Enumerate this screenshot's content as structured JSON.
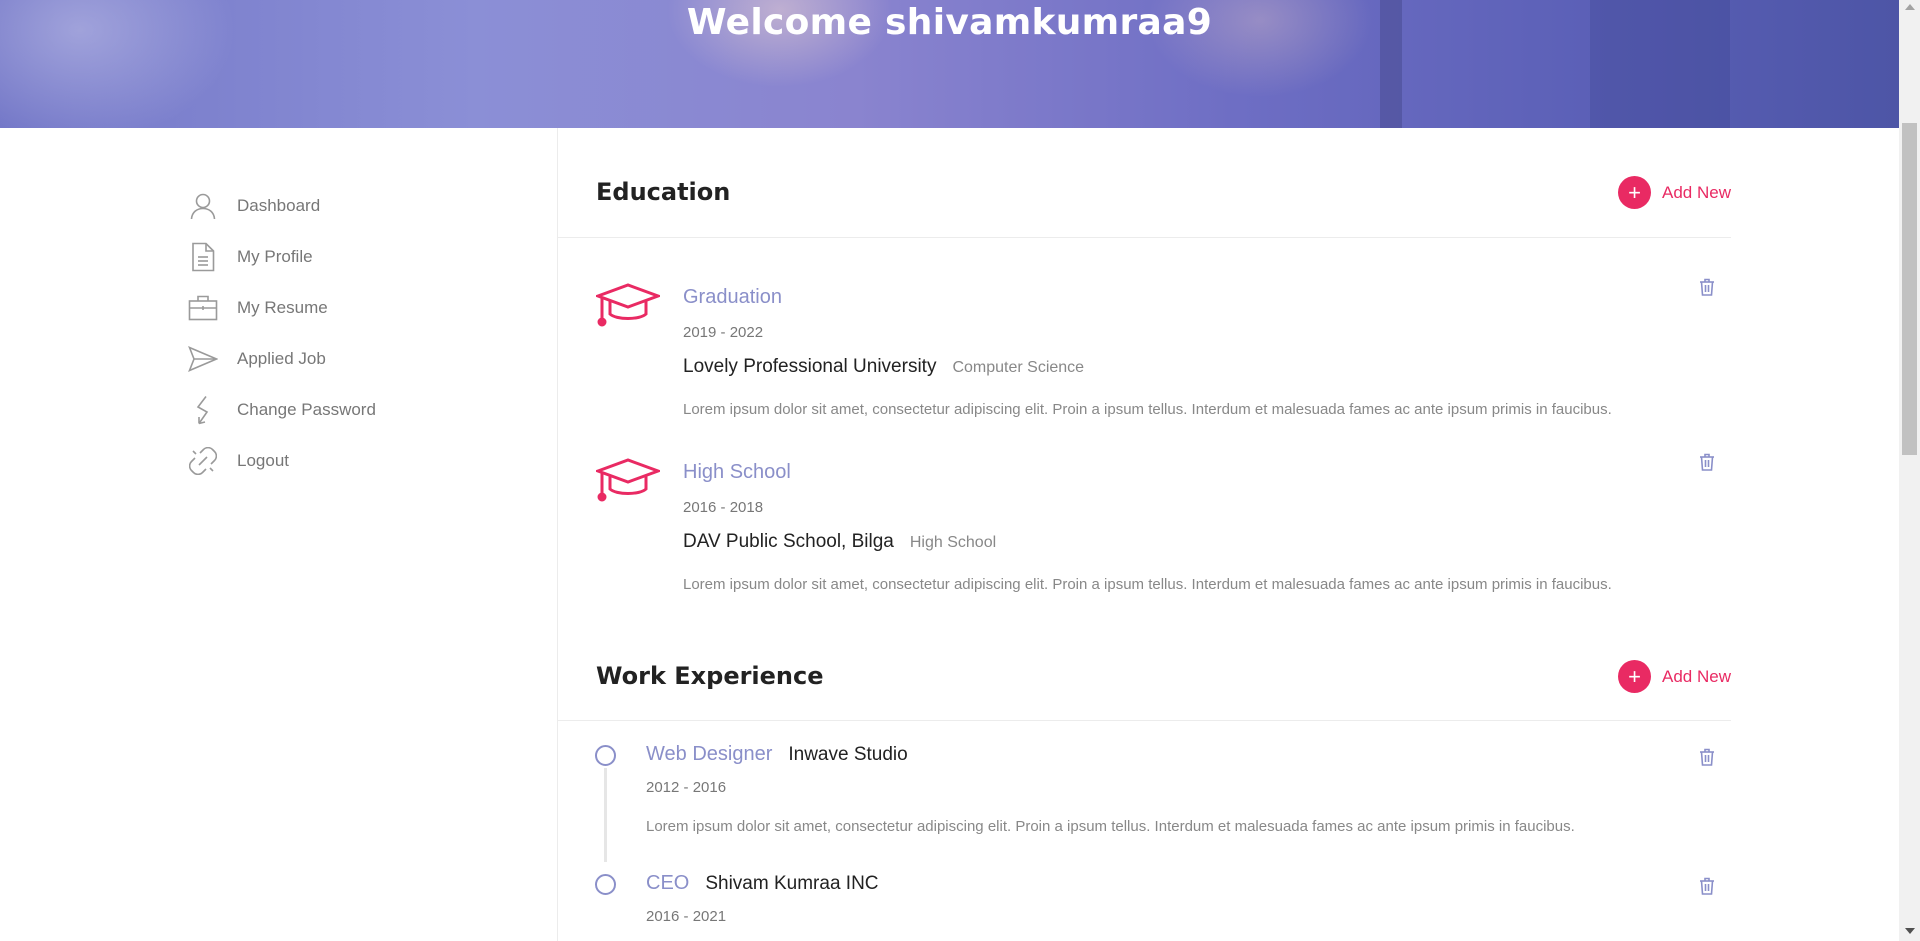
{
  "banner": {
    "title": "Welcome shivamkumraa9"
  },
  "sidebar": {
    "items": [
      {
        "label": "Dashboard",
        "icon": "user-icon"
      },
      {
        "label": "My Profile",
        "icon": "document-icon"
      },
      {
        "label": "My Resume",
        "icon": "briefcase-icon"
      },
      {
        "label": "Applied Job",
        "icon": "paper-plane-icon"
      },
      {
        "label": "Change Password",
        "icon": "lightning-icon"
      },
      {
        "label": "Logout",
        "icon": "broken-link-icon"
      }
    ]
  },
  "education": {
    "title": "Education",
    "add_label": "Add New",
    "items": [
      {
        "degree": "Graduation",
        "years": "2019 - 2022",
        "school": "Lovely Professional University",
        "field": "Computer Science",
        "description": "Lorem ipsum dolor sit amet, consectetur adipiscing elit. Proin a ipsum tellus. Interdum et malesuada fames ac ante ipsum primis in faucibus."
      },
      {
        "degree": "High School",
        "years": "2016 - 2018",
        "school": "DAV Public School, Bilga",
        "field": "High School",
        "description": "Lorem ipsum dolor sit amet, consectetur adipiscing elit. Proin a ipsum tellus. Interdum et malesuada fames ac ante ipsum primis in faucibus."
      }
    ]
  },
  "work": {
    "title": "Work Experience",
    "add_label": "Add New",
    "items": [
      {
        "title": "Web Designer",
        "company": "Inwave Studio",
        "years": "2012 - 2016",
        "description": "Lorem ipsum dolor sit amet, consectetur adipiscing elit. Proin a ipsum tellus. Interdum et malesuada fames ac ante ipsum primis in faucibus."
      },
      {
        "title": "CEO",
        "company": "Shivam Kumraa INC",
        "years": "2016 - 2021",
        "description": ""
      }
    ]
  },
  "colors": {
    "accent": "#e92a63",
    "muted_blue": "#8a8fc9"
  }
}
